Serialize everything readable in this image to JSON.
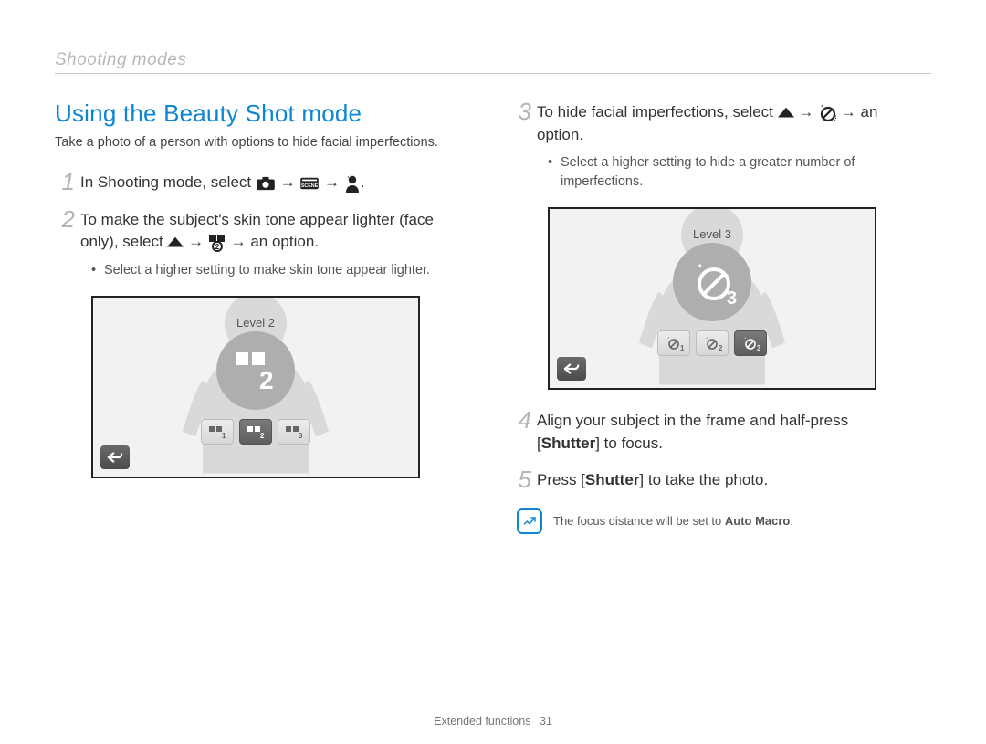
{
  "breadcrumb": "Shooting modes",
  "section_title": "Using the Beauty Shot mode",
  "lead": "Take a photo of a person with options to hide facial imperfections.",
  "steps_left": [
    {
      "n": "1",
      "fragments": [
        {
          "t": "text",
          "v": "In Shooting mode, select "
        },
        {
          "t": "icon",
          "name": "camera-icon"
        },
        {
          "t": "text",
          "v": " → "
        },
        {
          "t": "icon",
          "name": "scene-icon"
        },
        {
          "t": "text",
          "v": " → "
        },
        {
          "t": "icon",
          "name": "beauty-person-icon"
        },
        {
          "t": "text",
          "v": "."
        }
      ]
    },
    {
      "n": "2",
      "fragments": [
        {
          "t": "text",
          "v": "To make the subject's skin tone appear lighter (face only), select "
        },
        {
          "t": "icon",
          "name": "menu-up-icon"
        },
        {
          "t": "text",
          "v": " → "
        },
        {
          "t": "icon",
          "name": "face-tone-icon"
        },
        {
          "t": "text",
          "v": " → an option."
        }
      ],
      "bullets": [
        "Select a higher setting to make skin tone appear lighter."
      ]
    }
  ],
  "screen_left": {
    "level_label": "Level 2",
    "big_icon_char": "2",
    "chips": [
      "1",
      "2",
      "3"
    ],
    "selected_index": 1,
    "chip_prefix": "face-tone"
  },
  "steps_right": [
    {
      "n": "3",
      "fragments": [
        {
          "t": "text",
          "v": "To hide facial imperfections, select "
        },
        {
          "t": "icon",
          "name": "menu-up-icon"
        },
        {
          "t": "text",
          "v": " → "
        },
        {
          "t": "icon",
          "name": "face-retouch-icon"
        },
        {
          "t": "text",
          "v": " → an option."
        }
      ],
      "bullets": [
        "Select a higher setting to hide a greater number of imperfections."
      ]
    }
  ],
  "screen_right": {
    "level_label": "Level 3",
    "big_icon_char": "3",
    "chips": [
      "1",
      "2",
      "3"
    ],
    "selected_index": 2,
    "chip_prefix": "face-retouch"
  },
  "steps_right2": [
    {
      "n": "4",
      "fragments": [
        {
          "t": "text",
          "v": "Align your subject in the frame and half-press ["
        },
        {
          "t": "bold",
          "v": "Shutter"
        },
        {
          "t": "text",
          "v": "] to focus."
        }
      ]
    },
    {
      "n": "5",
      "fragments": [
        {
          "t": "text",
          "v": "Press ["
        },
        {
          "t": "bold",
          "v": "Shutter"
        },
        {
          "t": "text",
          "v": "] to take the photo."
        }
      ]
    }
  ],
  "note": {
    "text_before": "The focus distance will be set to ",
    "bold": "Auto Macro",
    "text_after": "."
  },
  "footer_section": "Extended functions",
  "footer_page": "31"
}
